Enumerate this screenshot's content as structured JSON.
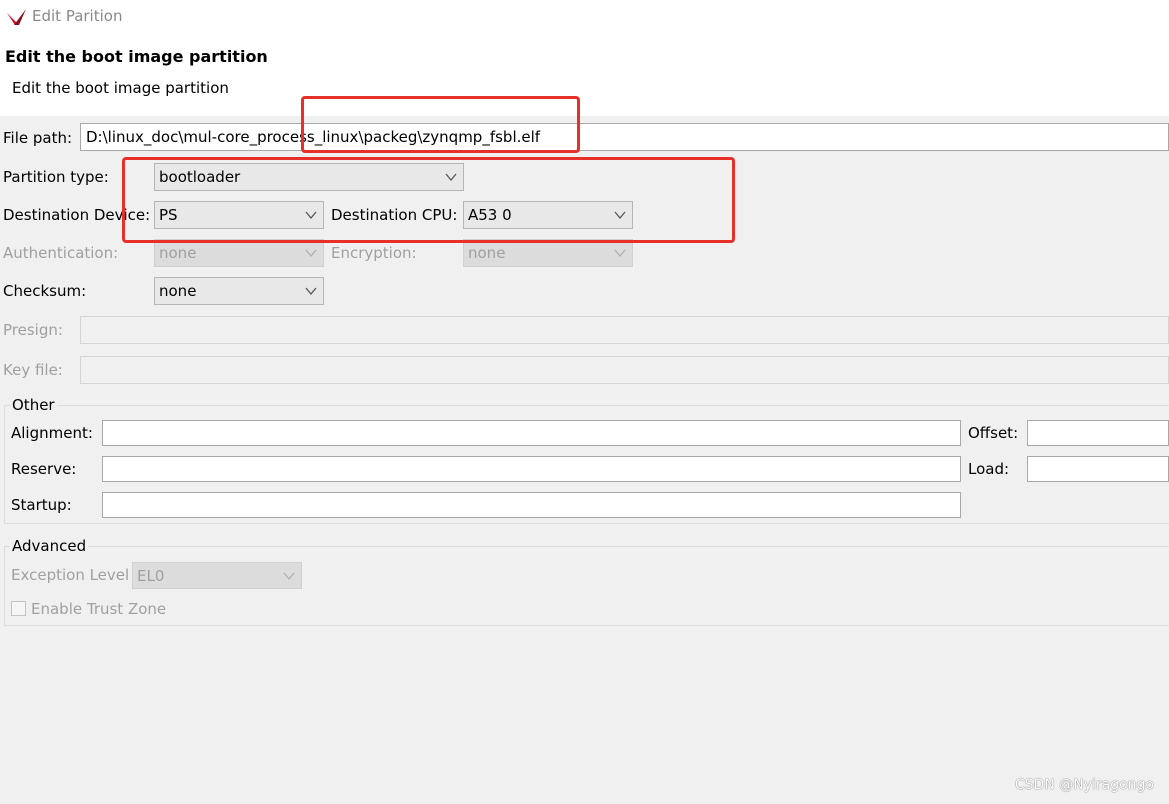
{
  "window": {
    "title": "Edit Parition"
  },
  "header": {
    "heading": "Edit the boot image partition",
    "description": "Edit the boot image partition"
  },
  "form": {
    "file_path_label": "File path:",
    "file_path_value": "D:\\linux_doc\\mul-core_process_linux\\packeg\\zynqmp_fsbl.elf",
    "partition_type_label": "Partition type:",
    "partition_type_value": "bootloader",
    "destination_device_label": "Destination Device:",
    "destination_device_value": "PS",
    "destination_cpu_label": "Destination CPU:",
    "destination_cpu_value": "A53 0",
    "authentication_label": "Authentication:",
    "authentication_value": "none",
    "encryption_label": "Encryption:",
    "encryption_value": "none",
    "checksum_label": "Checksum:",
    "checksum_value": "none",
    "presign_label": "Presign:",
    "keyfile_label": "Key file:"
  },
  "other_group": {
    "title": "Other",
    "alignment_label": "Alignment:",
    "offset_label": "Offset:",
    "reserve_label": "Reserve:",
    "load_label": "Load:",
    "startup_label": "Startup:"
  },
  "advanced_group": {
    "title": "Advanced",
    "exception_level_label": "Exception Level",
    "exception_level_value": "EL0",
    "trust_zone_label": "Enable Trust Zone",
    "trust_zone_checked": false
  },
  "watermark": "CSDN @Nyiragongo",
  "colors": {
    "annotation_red": "#e8302a",
    "disabled_text": "#a0a0a0",
    "app_icon_red": "#c8102e"
  },
  "icons": {
    "app": "xilinx-logo-icon",
    "dropdown": "chevron-down-icon"
  }
}
